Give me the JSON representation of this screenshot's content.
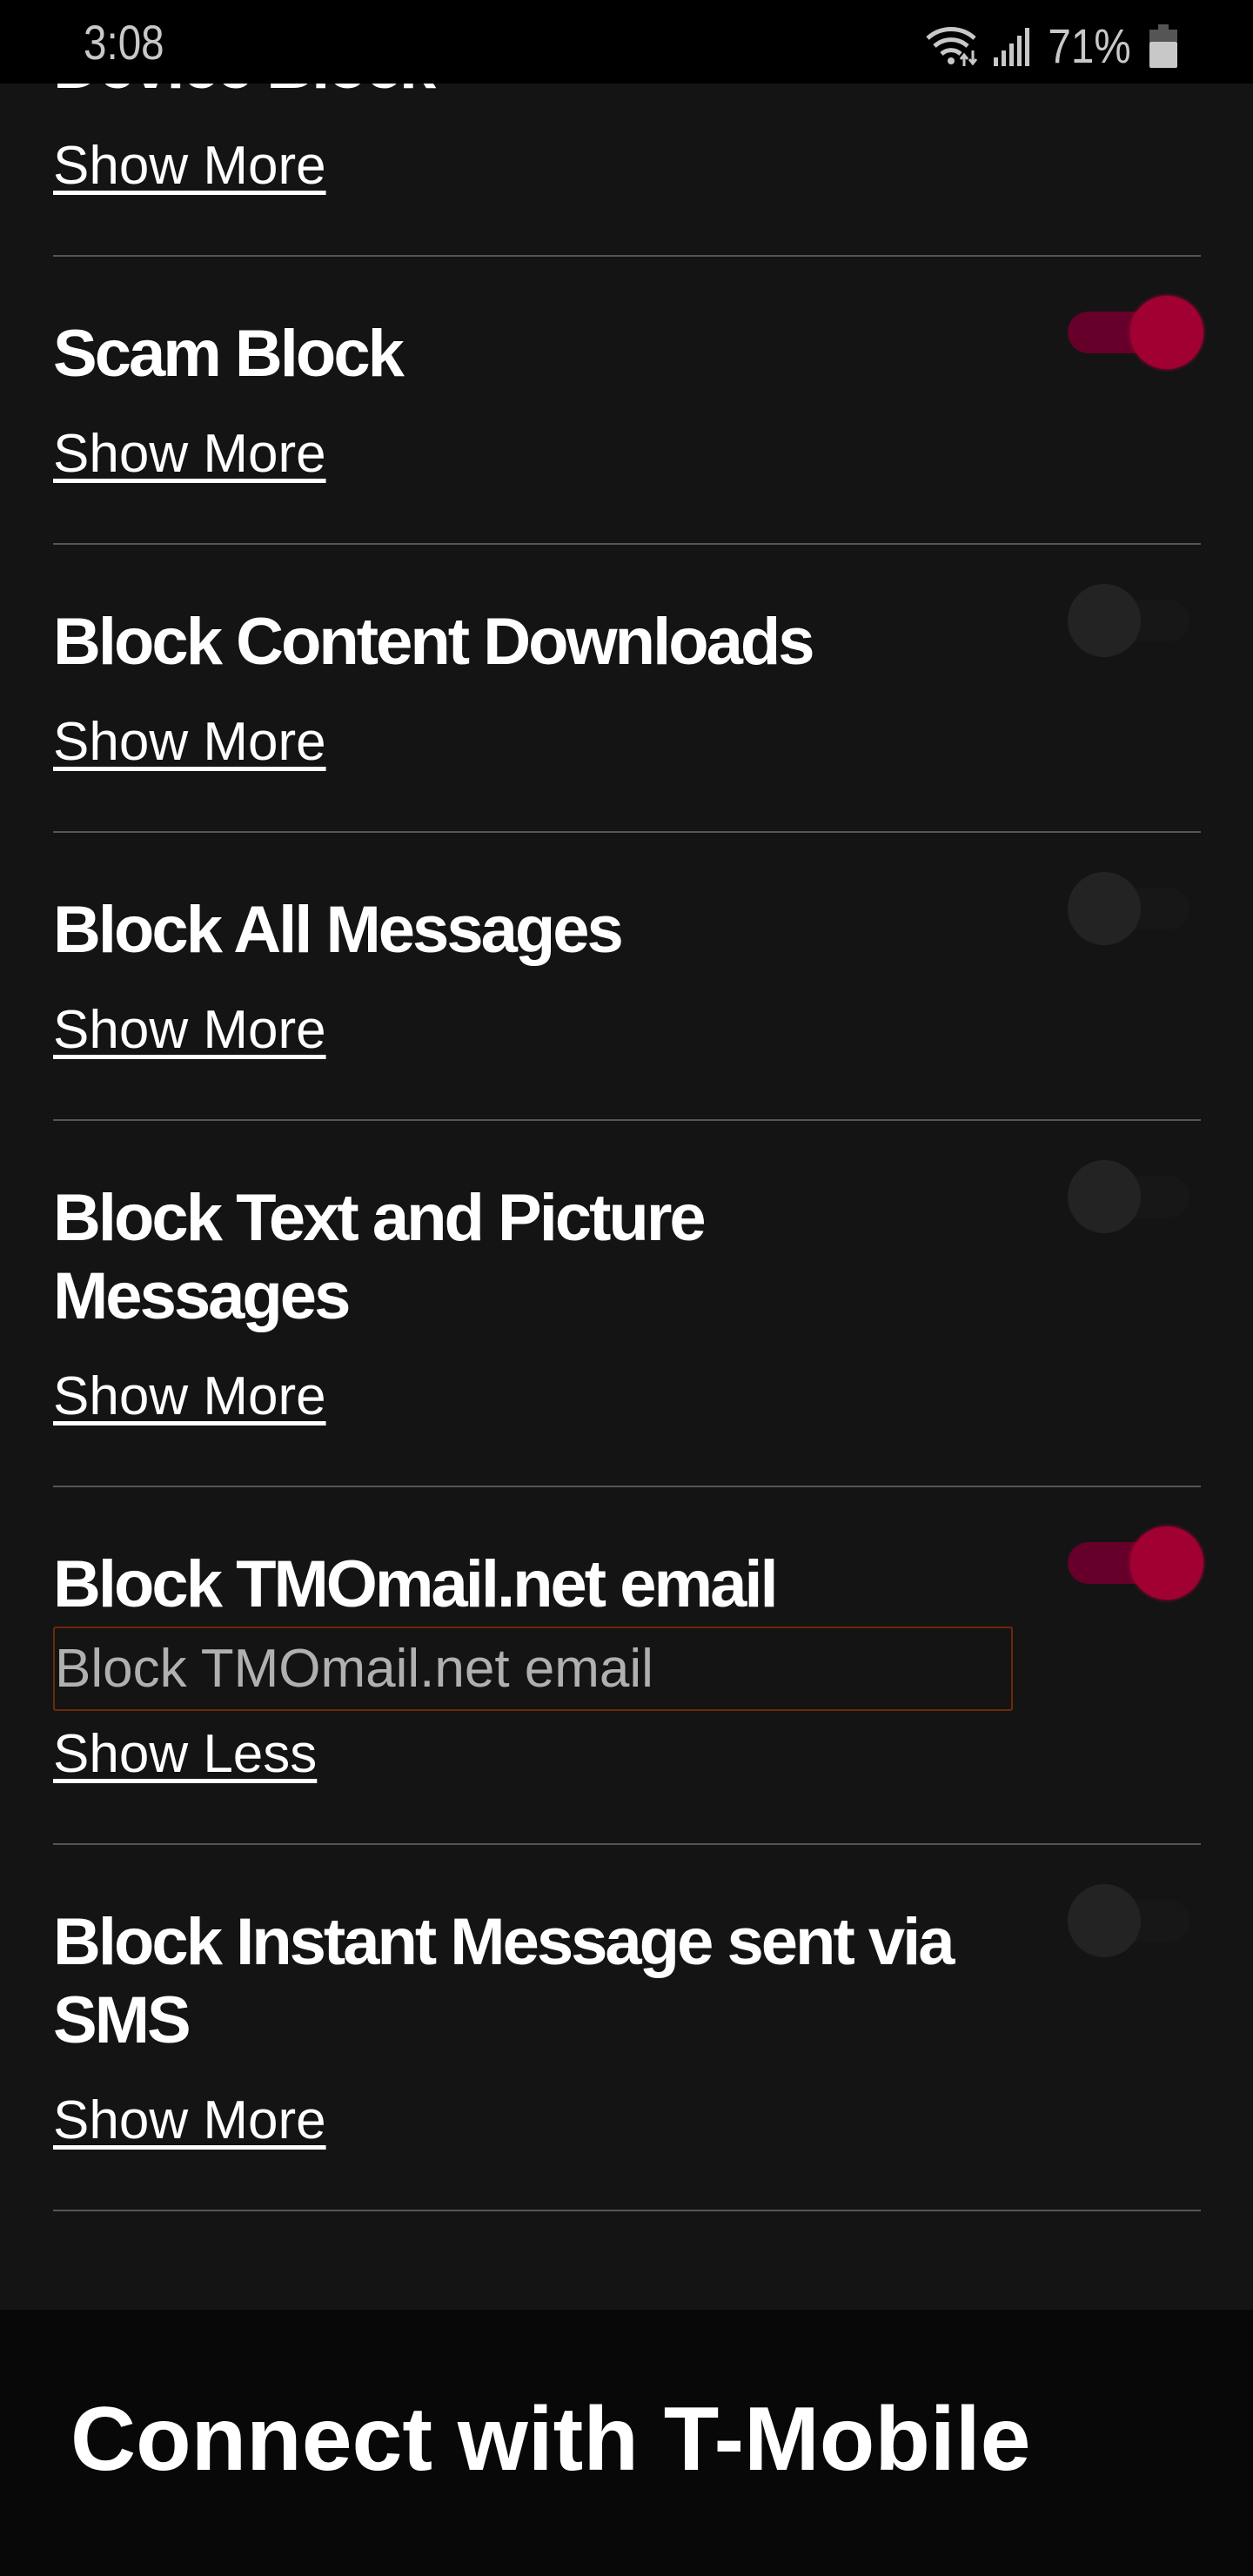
{
  "status_bar": {
    "time": "3:08",
    "battery": "71%",
    "icons": [
      "wifi-icon",
      "signal-icon",
      "battery-icon"
    ]
  },
  "items": [
    {
      "title": "Device Block",
      "link": "Show More",
      "toggle": null
    },
    {
      "title": "Scam Block",
      "link": "Show More",
      "toggle": true
    },
    {
      "title": "Block Content Downloads",
      "link": "Show More",
      "toggle": false
    },
    {
      "title": "Block All Messages",
      "link": "Show More",
      "toggle": false
    },
    {
      "title": "Block Text and Picture Messages",
      "link": "Show More",
      "toggle": false
    },
    {
      "title": "Block TMOmail.net email",
      "description": "Block TMOmail.net email",
      "link": "Show Less",
      "toggle": true
    },
    {
      "title": "Block Instant Message sent via SMS",
      "link": "Show More",
      "toggle": false
    }
  ],
  "footer": {
    "title": "Connect with T-Mobile"
  },
  "colors": {
    "background": "#141414",
    "accent": "#a00032",
    "accent_track": "#66002a",
    "divider": "#555555",
    "focus_border": "#6b2a0a"
  }
}
